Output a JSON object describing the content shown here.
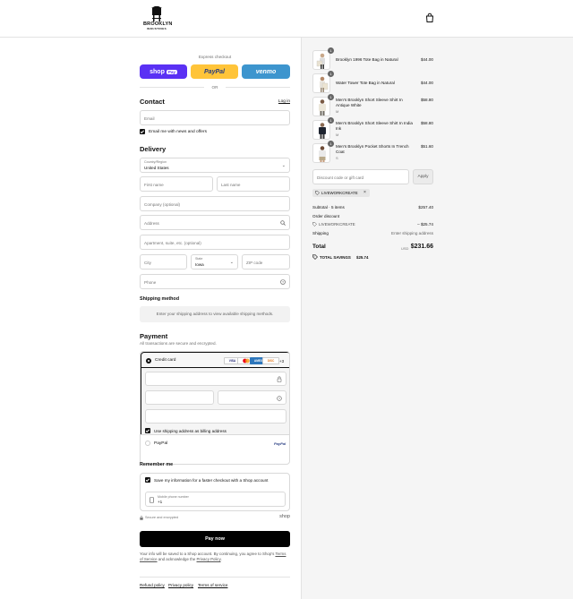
{
  "brand": {
    "name": "BROOKLYN",
    "sub": "INDUSTRIES"
  },
  "express": {
    "label": "Express checkout",
    "buttons": [
      {
        "label": "shop",
        "badge": "Pay",
        "color": "#5a31f4"
      },
      {
        "label": "PayPal",
        "color": "#ffc439"
      },
      {
        "label": "venmo",
        "color": "#3d95ce"
      }
    ],
    "or": "OR"
  },
  "contact": {
    "title": "Contact",
    "login": "Log in",
    "email_placeholder": "Email",
    "news_label": "Email me with news and offers"
  },
  "delivery": {
    "title": "Delivery",
    "country_label": "Country/Region",
    "country_value": "United States",
    "first_name": "First name",
    "last_name": "Last name",
    "company": "Company (optional)",
    "address": "Address",
    "apartment": "Apartment, suite, etc. (optional)",
    "city": "City",
    "state_label": "State",
    "state_value": "Iowa",
    "zip": "ZIP code",
    "phone": "Phone"
  },
  "shipping": {
    "title": "Shipping method",
    "message": "Enter your shipping address to view available shipping methods."
  },
  "payment": {
    "title": "Payment",
    "subtitle": "All transactions are secure and encrypted.",
    "credit_card": "Credit card",
    "cards": [
      "VISA",
      "MC",
      "AMEX",
      "DISC"
    ],
    "more_cards": "+3",
    "billing_label": "Use shipping address as billing address",
    "paypal": "PayPal",
    "paypal_logo": "PayPal"
  },
  "remember": {
    "title": "Remember me",
    "save_label": "Save my information for a faster checkout with a Shop account",
    "mobile_label": "Mobile phone number",
    "mobile_value": "+1",
    "secure": "Secure and encrypted",
    "shop": "shop"
  },
  "pay_button": "Pay now",
  "legal": {
    "text1": "Your info will be saved to a Shop account. By continuing, you agree to Shop's",
    "terms": "Terms of Service",
    "text2": "and acknowledge the",
    "privacy": "Privacy Policy",
    "end": "."
  },
  "footer_links": [
    "Refund policy",
    "Privacy policy",
    "Terms of service"
  ],
  "cart": {
    "items": [
      {
        "qty": "1",
        "name": "Brooklyn 1996 Tote Bag in Natural",
        "variant": "",
        "price": "$44.00"
      },
      {
        "qty": "1",
        "name": "Water Tower Tote Bag in Natural",
        "variant": "",
        "price": "$44.00"
      },
      {
        "qty": "1",
        "name": "Men's Brooklyn Short Sleeve Shirt In Antique White",
        "variant": "M",
        "price": "$58.80"
      },
      {
        "qty": "1",
        "name": "Men's Brooklyn Short Sleeve Shirt In India Ink",
        "variant": "M",
        "price": "$58.80"
      },
      {
        "qty": "1",
        "name": "Men's Brooklyn Pocket Shorts In Trench Coat",
        "variant": "S",
        "price": "$51.60"
      }
    ],
    "discount_placeholder": "Discount code or gift card",
    "apply": "Apply",
    "code": "LIVEWORKCREATE",
    "subtotal_label": "Subtotal · 5 items",
    "subtotal": "$257.40",
    "order_discount": "Order discount",
    "discount_code": "LIVEWORKCREATE",
    "discount_value": "– $25.74",
    "shipping_label": "Shipping",
    "shipping_value": "Enter shipping address",
    "total_label": "Total",
    "currency": "USD",
    "total": "$231.66",
    "savings_label": "TOTAL SAVINGS",
    "savings": "$25.74"
  }
}
